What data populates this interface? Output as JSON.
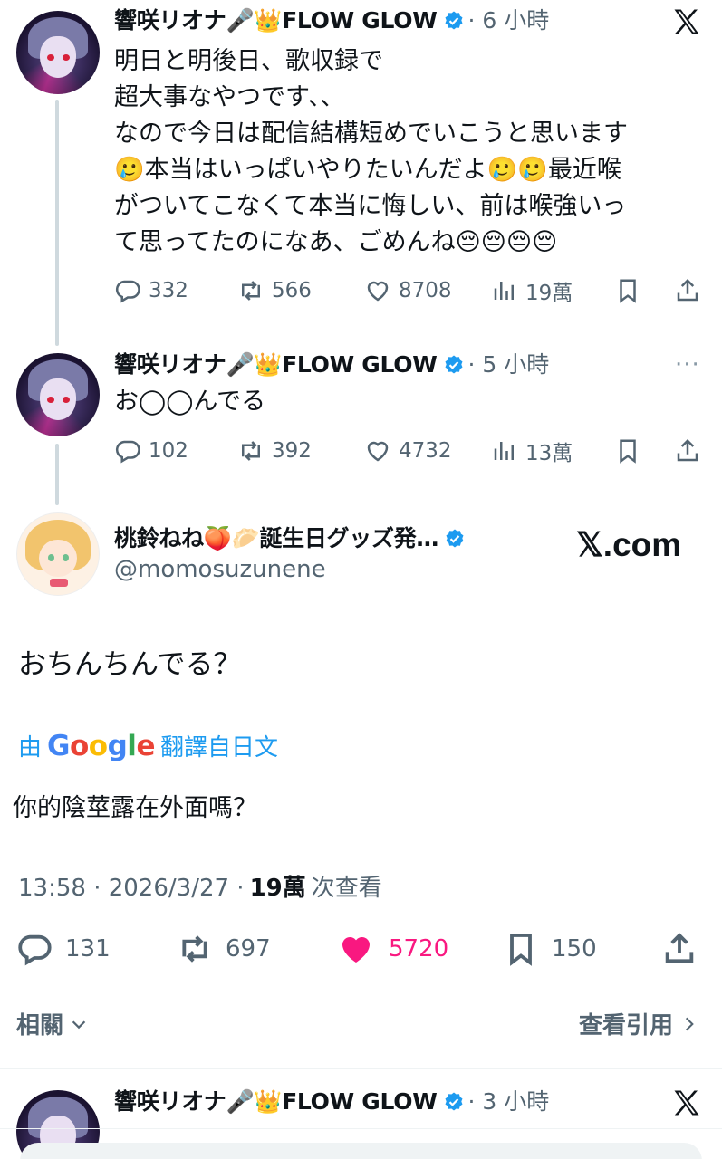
{
  "posts": [
    {
      "author": "響咲リオナ🎤👑FLOW GLOW",
      "time": "· 6 小時",
      "text": "明日と明後日、歌収録で\n超大事なやつです、、\nなので今日は配信結構短めでいこうと思います\n🥲本当はいっぱいやりたいんだよ🥲🥲最近喉\nがついてこなくて本当に悔しい、前は喉強いっ\nて思ってたのになあ、ごめんね😔😔😔😔",
      "stats": {
        "replies": "332",
        "reposts": "566",
        "likes": "8708",
        "views": "19萬"
      }
    },
    {
      "author": "響咲リオナ🎤👑FLOW GLOW",
      "time": "· 5 小時",
      "more": "···",
      "text": "お◯◯んでる",
      "stats": {
        "replies": "102",
        "reposts": "392",
        "likes": "4732",
        "views": "13萬"
      }
    }
  ],
  "main_post": {
    "author": "桃鈴ねね🍑🥟誕生日グッズ発…",
    "handle": "@momosuzunene",
    "watermark": "𝕏.com",
    "text": "おちんちんでる？",
    "translate_prefix": "由",
    "translate_brand": "Google",
    "translate_suffix": "翻譯自日文",
    "translated_text": "你的陰莖露在外面嗎？",
    "timestamp": "13:58 · 2026/3/27 ·",
    "views_count": "19萬",
    "views_label": "次查看",
    "stats": {
      "replies": "131",
      "reposts": "697",
      "likes": "5720",
      "bookmarks": "150"
    },
    "liked": true,
    "like_color": "#f91880"
  },
  "related_label": "相關",
  "view_quotes_label": "查看引用",
  "bottom_post": {
    "author": "響咲リオナ🎤👑FLOW GLOW",
    "time": "· 3 小時"
  },
  "colors": {
    "verified": "#1d9bf0",
    "link": "#1d9bf0",
    "muted": "#536471"
  }
}
